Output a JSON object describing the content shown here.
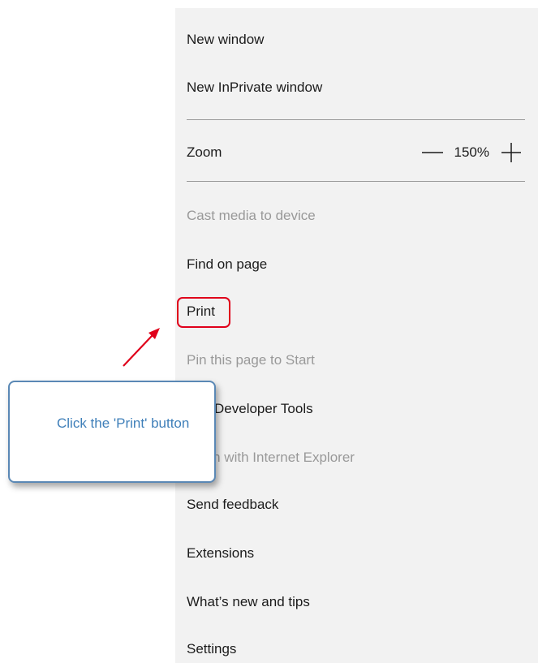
{
  "menu": {
    "items": [
      {
        "label": "New window",
        "enabled": true
      },
      {
        "label": "New InPrivate window",
        "enabled": true
      },
      {
        "label": "Zoom",
        "enabled": true
      },
      {
        "label": "Cast media to device",
        "enabled": false
      },
      {
        "label": "Find on page",
        "enabled": true
      },
      {
        "label": "Print",
        "enabled": true
      },
      {
        "label": "Pin this page to Start",
        "enabled": false
      },
      {
        "label": "F12 Developer Tools",
        "enabled": true
      },
      {
        "label": "Open with Internet Explorer",
        "enabled": false
      },
      {
        "label": "Send feedback",
        "enabled": true
      },
      {
        "label": "Extensions",
        "enabled": true
      },
      {
        "label": "What’s new and tips",
        "enabled": true
      },
      {
        "label": "Settings",
        "enabled": true
      }
    ],
    "zoom": {
      "value": "150%",
      "decrease_icon": "minus-icon",
      "increase_icon": "plus-icon"
    }
  },
  "callout": {
    "text": "Click the 'Print' button",
    "highlighted_item": "Print"
  },
  "colors": {
    "menu_background": "#f2f2f2",
    "text": "#1b1b1b",
    "disabled_text": "#999999",
    "highlight": "#e0001b",
    "callout_border": "#5a88b5",
    "callout_text": "#3f7fb9"
  }
}
